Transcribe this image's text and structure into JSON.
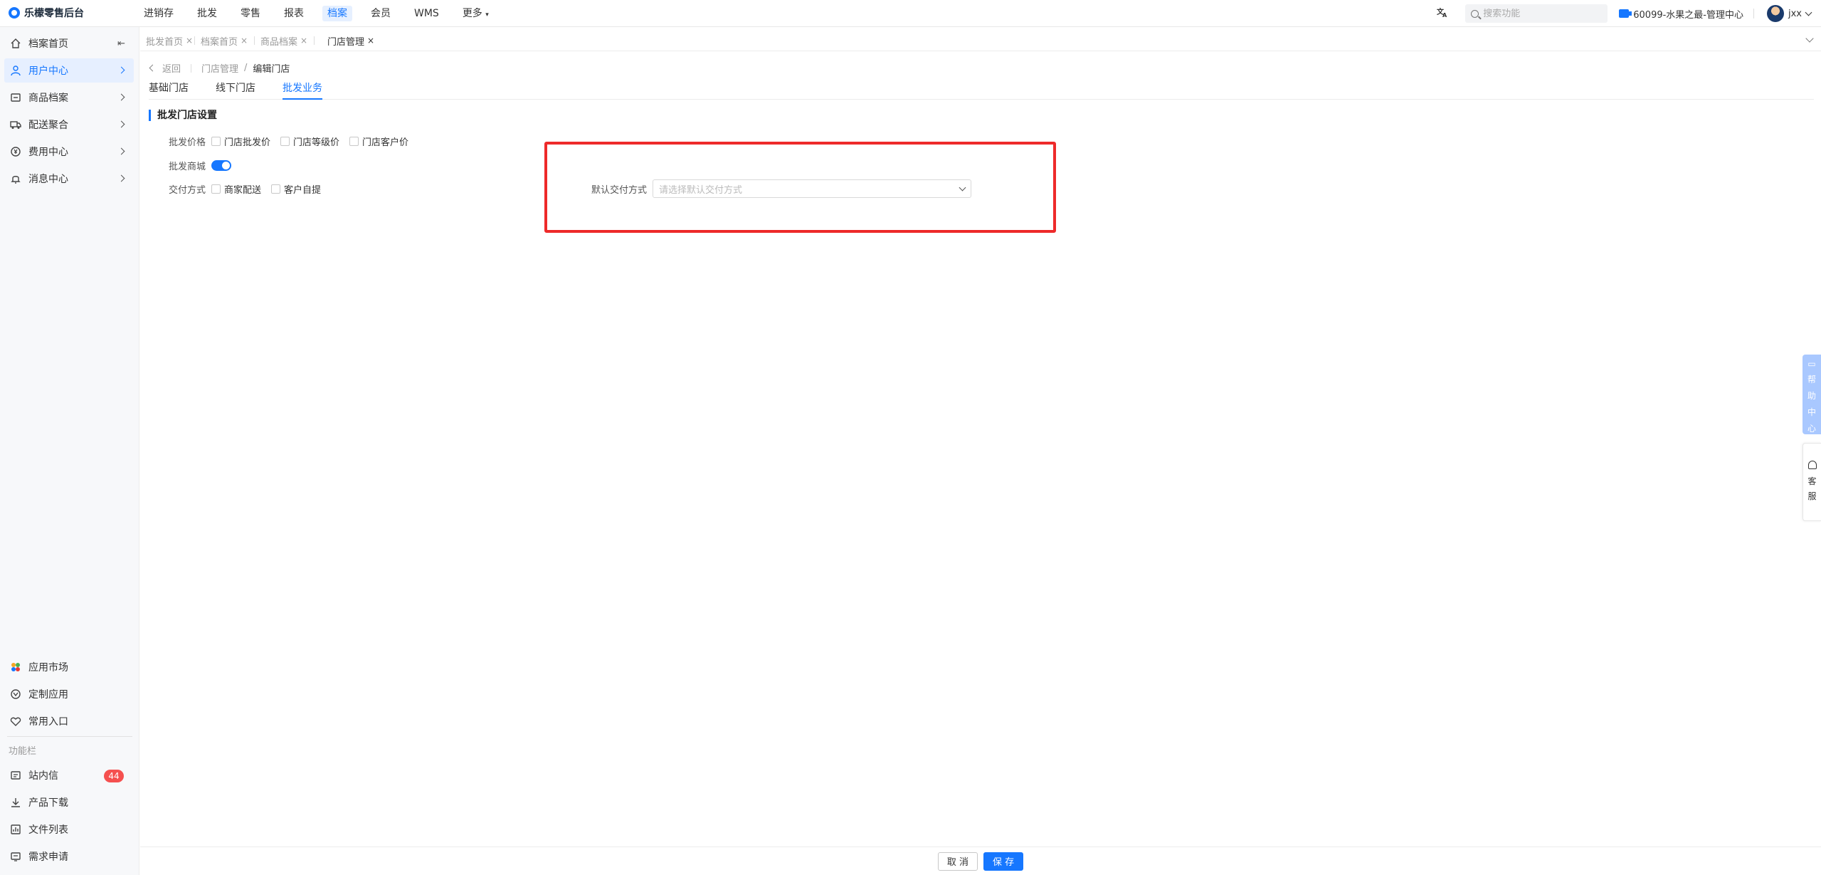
{
  "app": {
    "title": "乐檬零售后台"
  },
  "topnav": {
    "items": [
      "进销存",
      "批发",
      "零售",
      "报表",
      "档案",
      "会员",
      "WMS",
      "更多"
    ],
    "active_index": 4,
    "search_placeholder": "搜索功能",
    "store": "60099-水果之最-管理中心",
    "user": "jxx"
  },
  "sidebar": {
    "items": [
      {
        "label": "档案首页",
        "icon": "home-icon"
      },
      {
        "label": "用户中心",
        "icon": "user-icon",
        "active": true
      },
      {
        "label": "商品档案",
        "icon": "box-icon"
      },
      {
        "label": "配送聚合",
        "icon": "truck-icon"
      },
      {
        "label": "费用中心",
        "icon": "coin-icon"
      },
      {
        "label": "消息中心",
        "icon": "bell-icon"
      }
    ],
    "bottom_items": [
      {
        "label": "应用市场",
        "icon": "app-market-icon"
      },
      {
        "label": "定制应用",
        "icon": "custom-app-icon"
      },
      {
        "label": "常用入口",
        "icon": "heart-icon"
      }
    ],
    "group_label": "功能栏",
    "func_items": [
      {
        "label": "站内信",
        "icon": "mail-icon",
        "badge": "44"
      },
      {
        "label": "产品下载",
        "icon": "download-icon"
      },
      {
        "label": "文件列表",
        "icon": "file-list-icon"
      },
      {
        "label": "需求申请",
        "icon": "request-icon"
      }
    ]
  },
  "tabs": [
    {
      "label": "批发首页",
      "active": false
    },
    {
      "label": "档案首页",
      "active": false
    },
    {
      "label": "商品档案",
      "active": false
    },
    {
      "label": "门店管理",
      "active": true
    }
  ],
  "breadcrumb": {
    "back": "返回",
    "parent": "门店管理",
    "current": "编辑门店"
  },
  "subtabs": {
    "items": [
      "基础门店",
      "线下门店",
      "批发业务"
    ],
    "active_index": 2
  },
  "section": {
    "title": "批发门店设置",
    "price_label": "批发价格",
    "price_options": [
      "门店批发价",
      "门店等级价",
      "门店客户价"
    ],
    "mall_label": "批发商城",
    "mall_enabled": true,
    "delivery_label": "交付方式",
    "delivery_options": [
      "商家配送",
      "客户自提"
    ],
    "default_delivery_label": "默认交付方式",
    "default_delivery_placeholder": "请选择默认交付方式"
  },
  "footer": {
    "cancel": "取 消",
    "save": "保 存"
  },
  "floating": {
    "help": [
      "帮",
      "助",
      "中",
      "心"
    ],
    "service": [
      "客",
      "服"
    ]
  },
  "colors": {
    "accent": "#1677ff",
    "highlight": "#ee2a2a",
    "badge": "#f5504f"
  }
}
